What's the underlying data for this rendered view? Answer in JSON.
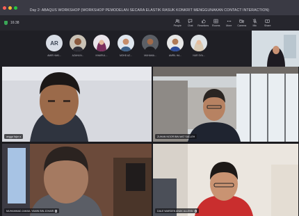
{
  "window": {
    "title": "Day 2: ABAQUS WORKSHOP (WORKSHOP PEMODELAN SECARA ELASTIK RASUK KONKRIT MENGGUNAKAN CONTACT INTERACTION)"
  },
  "toolbar": {
    "elapsed_time": "16:38",
    "tools": [
      {
        "label": "People",
        "icon": "people-icon"
      },
      {
        "label": "Chat",
        "icon": "chat-icon"
      },
      {
        "label": "Reactions",
        "icon": "reactions-icon"
      },
      {
        "label": "Rooms",
        "icon": "rooms-icon"
      },
      {
        "label": "More",
        "icon": "more-icon"
      },
      {
        "label": "Camera",
        "icon": "camera-icon"
      },
      {
        "label": "Mic",
        "icon": "mic-icon"
      },
      {
        "label": "Share",
        "icon": "share-icon"
      }
    ],
    "leave_label": "Leave"
  },
  "strip": {
    "participants": [
      {
        "initials": "AR",
        "name": "AMIR HAKI..."
      },
      {
        "name": "AZAHLIN..."
      },
      {
        "name": "KHAIRUL..."
      },
      {
        "name": "MOHD AZ..."
      },
      {
        "name": "MUHAMA..."
      },
      {
        "name": "AMRIL HA..."
      },
      {
        "name": "NUR SYA..."
      }
    ]
  },
  "tiles": [
    {
      "name": "angga fajar a"
    },
    {
      "name": "ZUHAN NOOR BIN MAT SALLEH"
    },
    {
      "name": "MUHAMMAD JAMIUL YAMIN BIN JOHARI"
    },
    {
      "name": "DALE WARDEN ANAK ALLENN"
    }
  ],
  "colors": {
    "leave_button": "#c4314b",
    "active_speaker_border": "#6b6ed8",
    "toolbar_bg": "#26262d"
  }
}
